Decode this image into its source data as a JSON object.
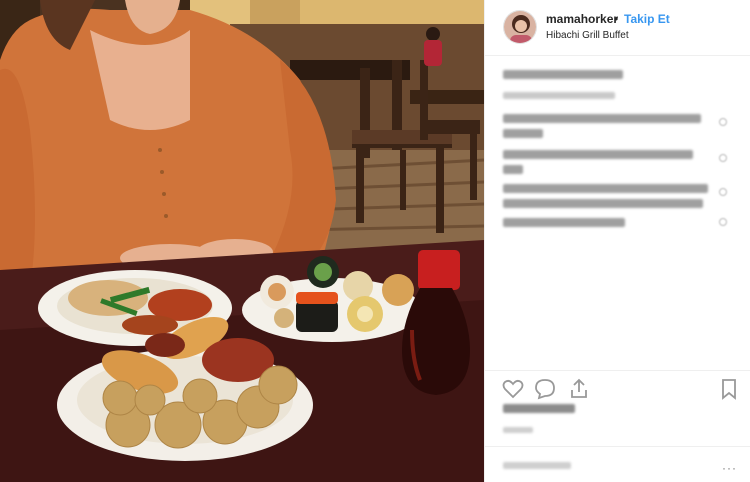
{
  "post": {
    "username": "mamahorker",
    "separator": "•",
    "follow_label": "Takip Et",
    "location": "Hibachi Grill Buffet",
    "more_label": "···"
  },
  "icons": {
    "like": "heart-icon",
    "comment": "comment-icon",
    "share": "share-icon",
    "save": "bookmark-icon"
  },
  "colors": {
    "follow": "#3897f0",
    "border": "#efefef"
  }
}
